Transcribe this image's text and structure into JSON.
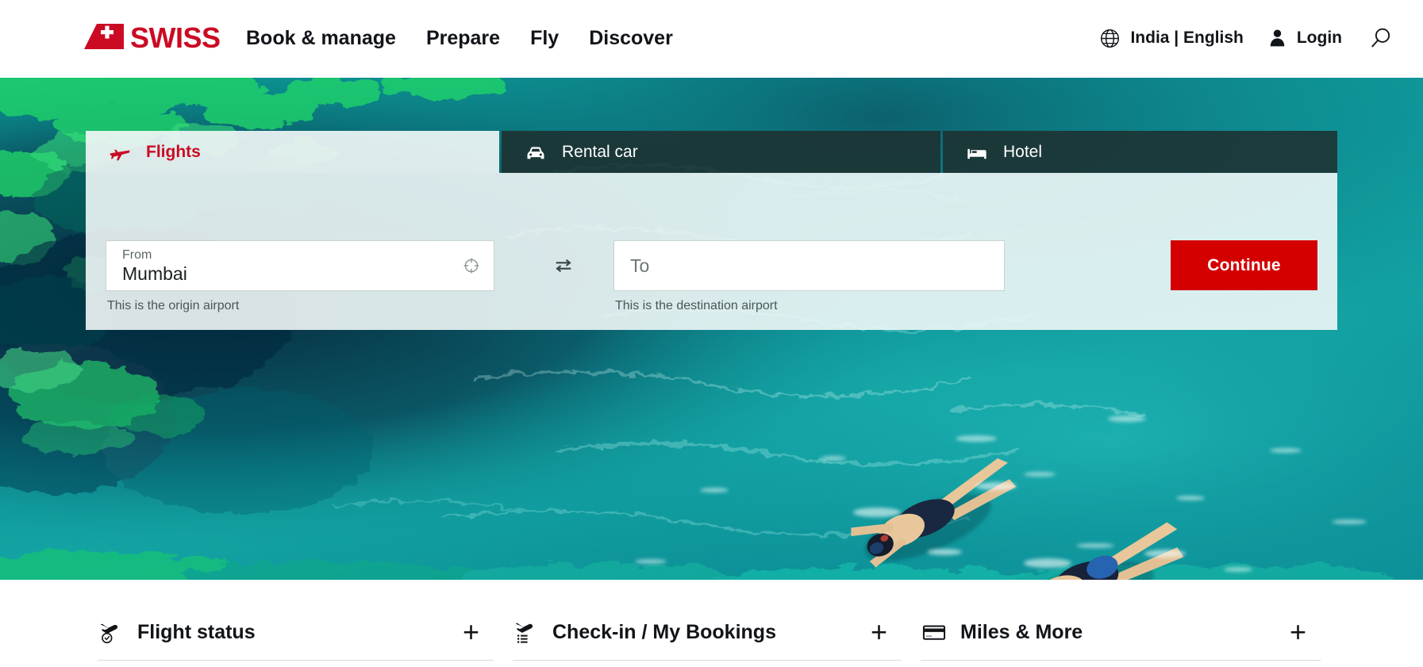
{
  "header": {
    "logo": {
      "icon": "swiss-tailfin-logo",
      "wordmark": "SWISS",
      "color": "#cb0b23"
    },
    "nav_items": [
      {
        "label": "Book & manage"
      },
      {
        "label": "Prepare"
      },
      {
        "label": "Fly"
      },
      {
        "label": "Discover"
      }
    ],
    "locale": {
      "icon": "globe-icon",
      "label": "India | English"
    },
    "login": {
      "icon": "user-icon",
      "label": "Login"
    },
    "search": {
      "icon": "search-icon"
    }
  },
  "hero": {
    "image_description": "Aerial view of two snorkelers swimming in turquoise ocean water over a coral reef"
  },
  "booking": {
    "tabs": [
      {
        "label": "Flights",
        "icon": "airplane-icon",
        "active": true
      },
      {
        "label": "Rental car",
        "icon": "car-icon",
        "active": false
      },
      {
        "label": "Hotel",
        "icon": "bed-icon",
        "active": false
      }
    ],
    "from_field": {
      "label": "From",
      "value": "Mumbai",
      "hint": "This is the origin airport",
      "icon": "locate-crosshair-icon"
    },
    "swap": {
      "icon": "swap-arrows-icon"
    },
    "to_field": {
      "label": "To",
      "placeholder": "To",
      "value": "",
      "hint": "This is the destination airport"
    },
    "continue_label": "Continue",
    "accent_color": "#d40000"
  },
  "quicklinks": [
    {
      "label": "Flight status",
      "icon": "plane-clock-icon",
      "expand": "+"
    },
    {
      "label": "Check-in / My Bookings",
      "icon": "plane-list-icon",
      "expand": "+"
    },
    {
      "label": "Miles & More",
      "icon": "credit-card-icon",
      "expand": "+"
    }
  ]
}
